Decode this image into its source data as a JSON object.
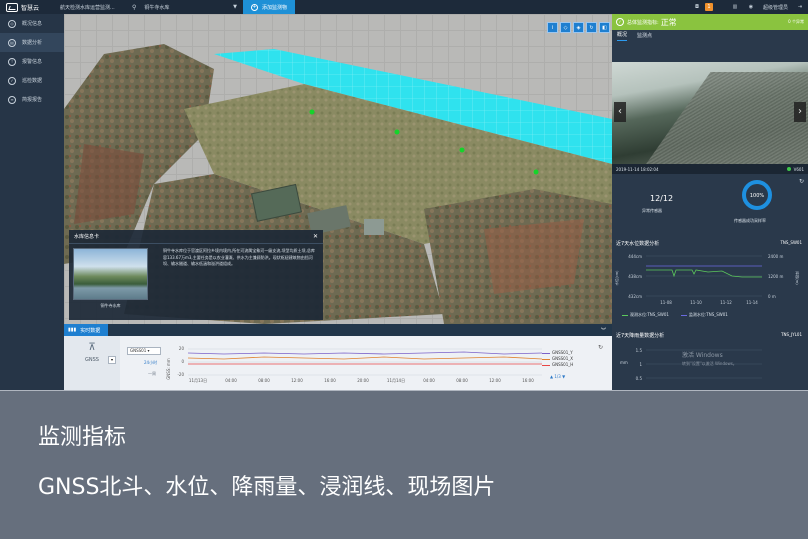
{
  "topbar": {
    "logo_text": "智慧云",
    "org_name": "航天检测水库运营监测...",
    "location": "铜牛寺水库",
    "add_button": "添加监测物",
    "alert_count": "1",
    "user_name": "超级管理员"
  },
  "sidebar": {
    "items": [
      {
        "label": "概况信息",
        "icon": "overview-icon"
      },
      {
        "label": "数据分析",
        "icon": "analysis-icon"
      },
      {
        "label": "报警信息",
        "icon": "alarm-icon"
      },
      {
        "label": "巡检数据",
        "icon": "inspection-icon"
      },
      {
        "label": "简报报告",
        "icon": "report-icon"
      }
    ]
  },
  "info_card": {
    "title": "水库信息卡",
    "photo_caption": "铜牛寺水库",
    "description": "铜牛寺水库位于官渡区阿拉乡境内境内,所在河流属宝象河一级支流,坝型均质土坝,总库容133.67万m3,主要任务是以农业灌溉、供水为主兼顾防洪。现状枢纽建筑物由挡河坝、输水隧道、输水低涵和溢洪道组成。"
  },
  "bottom": {
    "tab_label": "实时数据",
    "device_label": "GNSS",
    "select_value": "GNSS01",
    "sub_label_1": "24小时",
    "sub_label_2": "一周",
    "y_axis_label": "GNSS: mm",
    "y_ticks": [
      "20",
      "0",
      "-20"
    ],
    "x_ticks": [
      "11月13日",
      "04:00",
      "08:00",
      "12:00",
      "16:00",
      "20:00",
      "11月14日",
      "04:00",
      "08:00",
      "12:00",
      "16:00"
    ],
    "legend": [
      {
        "name": "GNSS01_Y",
        "color": "#7b62c9"
      },
      {
        "name": "GNSS01_X",
        "color": "#e0812e"
      },
      {
        "name": "GNSS01_H",
        "color": "#e84646"
      }
    ],
    "page_indicator": "1/3"
  },
  "right_panel": {
    "status_label": "总体监测指标:",
    "status_value": "正常",
    "status_count": "0 个异常",
    "tabs": [
      "概况",
      "监测点"
    ],
    "camera_time": "2019-11-14 18:02:04",
    "camera_id": "V601",
    "sensor_count": "12/12",
    "sensor_label": "异常传感器",
    "sensor_rate": "100%",
    "sensor_rate_label": "传感器成功采样率",
    "water_title": "近7天水位数据分析",
    "water_id": "TNS_SW01",
    "water_y_left": [
      "444cm",
      "438cm",
      "432cm"
    ],
    "water_y_right": [
      "2400 m",
      "1200 m",
      "0 m"
    ],
    "water_y_label_left": "水位(cm)",
    "water_y_label_right": "库容(m)",
    "water_x": [
      "11-08",
      "11-10",
      "11-12",
      "11-14"
    ],
    "water_legend": [
      {
        "name": "观测水位:TNS_SW01",
        "color": "#5cc85c"
      },
      {
        "name": "监测水位:TNS_SW01",
        "color": "#6a6ae0"
      }
    ],
    "rain_title": "近7天降雨量数据分析",
    "rain_id": "TNS_JYL01",
    "rain_y": [
      "1.5",
      "1",
      "0.5"
    ],
    "rain_y_label": "mm",
    "watermark_line1": "激活 Windows",
    "watermark_line2": "转到\"设置\"以激活 Windows。"
  },
  "caption": {
    "title": "监测指标",
    "subtitle": "GNSS北斗、水位、降雨量、浸润线、现场图片"
  }
}
